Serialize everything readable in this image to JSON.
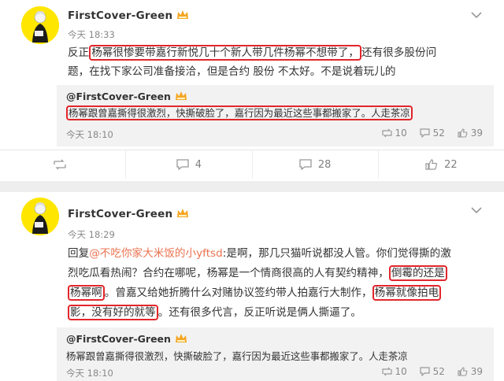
{
  "posts": [
    {
      "username": "FirstCover-Green",
      "time": "今天 18:33",
      "text": {
        "t1": "反正",
        "h1": "杨幂很惨要带嘉行新悦几十个新人带几件杨幂不想带了，",
        "t2": "还有很多股份问",
        "t3": "题，在找下家公司准备接洽，但是合约 股份 不太好。不是说着玩儿的"
      },
      "repost": {
        "username": "@FirstCover-Green",
        "text": "杨幂跟曾嘉撕得很激烈，快撕破脸了，嘉行因为最近这些事都搬家了。人走茶凉",
        "time": "今天 18:10",
        "reposts": "10",
        "comments": "52",
        "likes": "39"
      },
      "actions": {
        "reposts": "",
        "comments": "4",
        "comments2": "28",
        "likes": "22"
      }
    },
    {
      "username": "FirstCover-Green",
      "time": "今天 18:29",
      "text": {
        "p1": "回复",
        "mention": "@不吃你家大米饭的小yftsd",
        "p2": ":是啊，那几只猫听说都没人管。你们觉得撕的激",
        "p3": "烈吃瓜看热闹？合约在哪呢，杨幂是一个情商很高的人有契约精神，",
        "h1": "倒霉的还是",
        "h2": "杨幂啊",
        "p4": "。曾嘉又给她折腾什么对赌协议签约带人拍嘉行大制作，",
        "h3": "杨幂就像拍电",
        "h4": "影，没有好的就等",
        "p5": "。还有很多代言，反正听说是俩人撕逼了。"
      },
      "repost": {
        "username": "@FirstCover-Green",
        "text": "杨幂跟曾嘉撕得很激烈，快撕破脸了，嘉行因为最近这些事都搬家了。人走茶凉",
        "time": "今天 18:10",
        "reposts": "10",
        "comments": "52",
        "likes": "39"
      }
    }
  ],
  "colors": {
    "highlight": "#e2262b",
    "avatar_bg": "#ffe600",
    "mention": "#eb7350",
    "vip": "#f5a623"
  }
}
